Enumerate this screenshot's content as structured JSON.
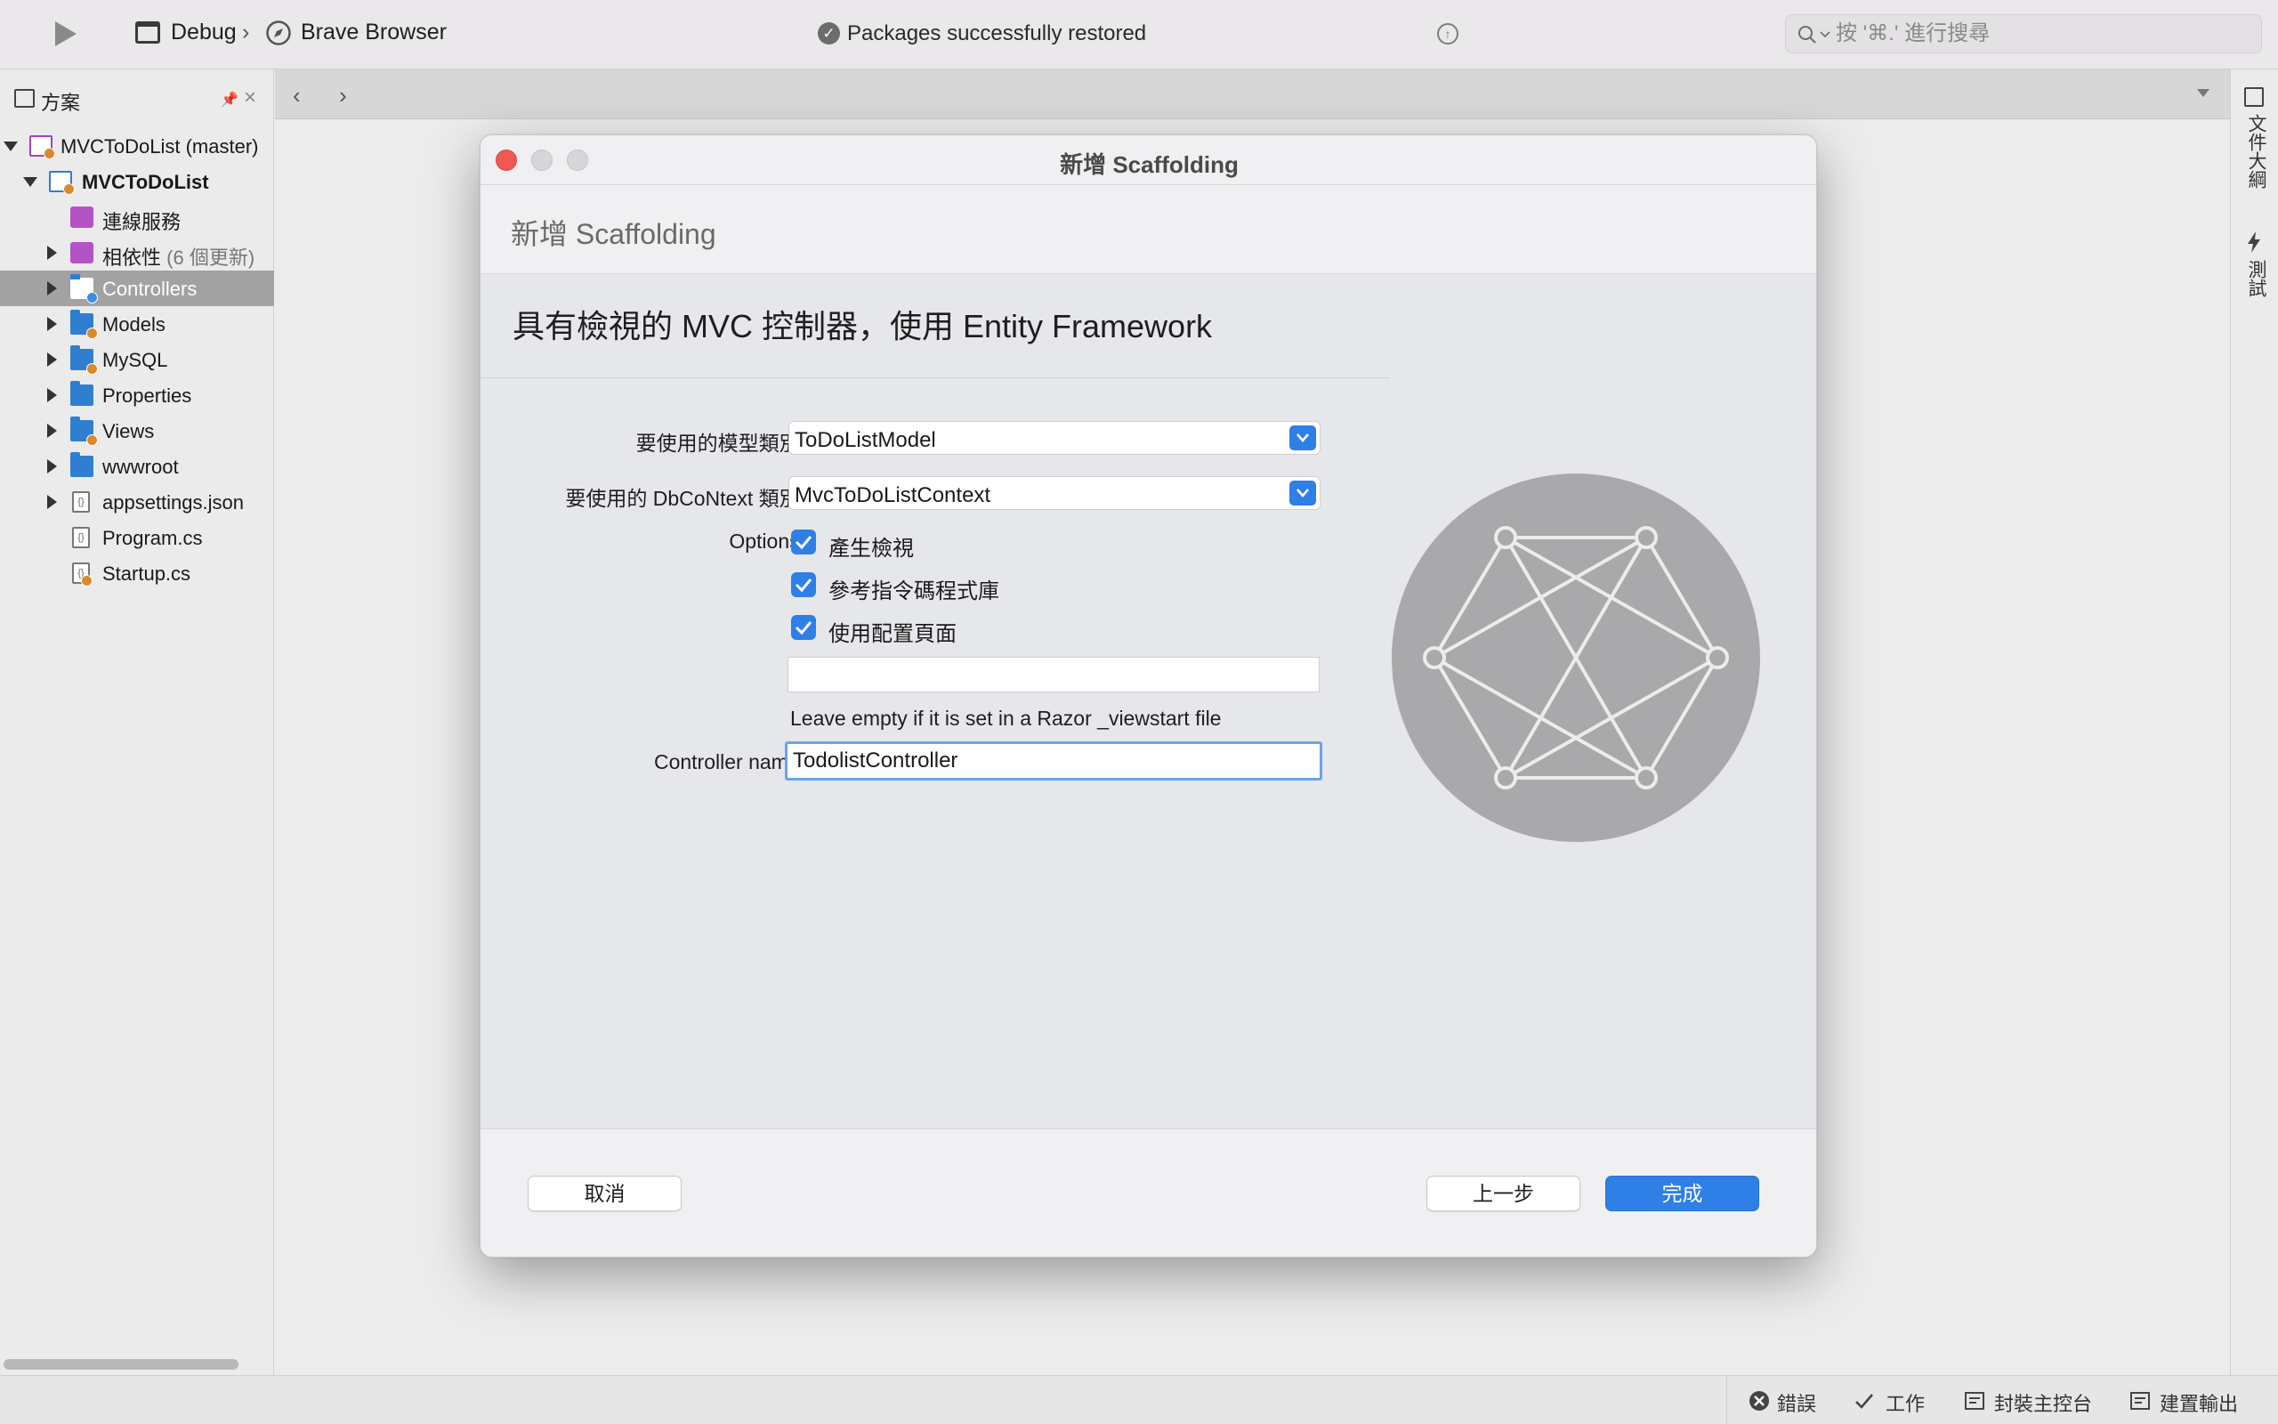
{
  "toolbar": {
    "configuration": "Debug",
    "separator": "›",
    "target_browser": "Brave Browser",
    "status_text": "Packages successfully restored",
    "search_placeholder": "按 '⌘.' 進行搜尋"
  },
  "solution_pad": {
    "title": "方案",
    "tree": [
      {
        "label": "MVCToDoList (master)",
        "icon": "solution-icon",
        "expanded": true
      },
      {
        "label": "MVCToDoList",
        "icon": "project-icon",
        "expanded": true,
        "bold": true
      },
      {
        "label": "連線服務",
        "icon": "connected-services-icon"
      },
      {
        "label": "相依性",
        "sub": "(6 個更新)",
        "icon": "dependencies-icon",
        "expandable": true
      },
      {
        "label": "Controllers",
        "icon": "folder-icon",
        "expandable": true,
        "selected": true
      },
      {
        "label": "Models",
        "icon": "folder-icon",
        "expandable": true
      },
      {
        "label": "MySQL",
        "icon": "folder-icon",
        "expandable": true
      },
      {
        "label": "Properties",
        "icon": "folder-icon",
        "expandable": true
      },
      {
        "label": "Views",
        "icon": "folder-icon",
        "expandable": true
      },
      {
        "label": "wwwroot",
        "icon": "folder-icon",
        "expandable": true
      },
      {
        "label": "appsettings.json",
        "icon": "json-file-icon",
        "expandable": true
      },
      {
        "label": "Program.cs",
        "icon": "cs-file-icon"
      },
      {
        "label": "Startup.cs",
        "icon": "cs-file-icon"
      }
    ]
  },
  "right_pads": {
    "outline": "文件大綱",
    "test": "測試"
  },
  "statusbar": {
    "errors": "錯誤",
    "tasks": "工作",
    "package_console": "封裝主控台",
    "build_output": "建置輸出"
  },
  "dialog": {
    "window_title": "新增 Scaffolding",
    "header_title": "新增 Scaffolding",
    "heading": "具有檢視的 MVC 控制器，使用 Entity Framework",
    "model_class_label": "要使用的模型類別:",
    "model_class_value": "ToDoListModel",
    "dbcontext_label": "要使用的 DbCoNtext 類別:",
    "dbcontext_value": "MvcToDoListContext",
    "options_label": "Options:",
    "options": [
      {
        "label": "產生檢視",
        "checked": true
      },
      {
        "label": "參考指令碼程式庫",
        "checked": true
      },
      {
        "label": "使用配置頁面",
        "checked": true
      }
    ],
    "layout_page_value": "",
    "layout_hint": "Leave empty if it is set in a Razor _viewstart file",
    "controller_name_label": "Controller name:",
    "controller_name_value": "TodolistController",
    "cancel_button": "取消",
    "back_button": "上一步",
    "finish_button": "完成"
  },
  "colors": {
    "accent": "#2e7fe6",
    "selection": "#a2a2a2",
    "close_button": "#ee5a52",
    "illustration": "#a9a9ab"
  }
}
